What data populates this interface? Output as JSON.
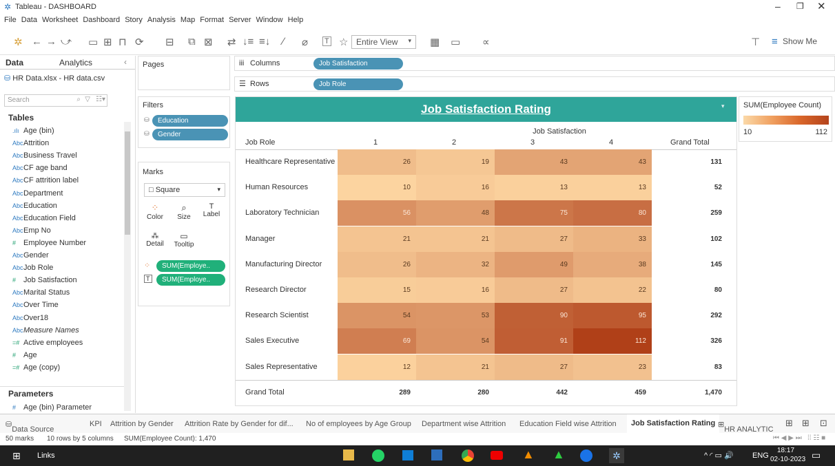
{
  "app_title": "Tableau - DASHBOARD",
  "menu": [
    "File",
    "Data",
    "Worksheet",
    "Dashboard",
    "Story",
    "Analysis",
    "Map",
    "Format",
    "Server",
    "Window",
    "Help"
  ],
  "toolbar": {
    "view_mode": "Entire View",
    "show_me": "Show Me"
  },
  "data_pane": {
    "tab_data": "Data",
    "tab_analytics": "Analytics",
    "datasource": "HR Data.xlsx - HR data.csv",
    "search_placeholder": "Search",
    "tables_header": "Tables",
    "fields": [
      {
        "type": ".ılı",
        "name": "Age (bin)"
      },
      {
        "type": "Abc",
        "name": "Attrition"
      },
      {
        "type": "Abc",
        "name": "Business Travel"
      },
      {
        "type": "Abc",
        "name": "CF age band"
      },
      {
        "type": "Abc",
        "name": "CF attrition label"
      },
      {
        "type": "Abc",
        "name": "Department"
      },
      {
        "type": "Abc",
        "name": "Education"
      },
      {
        "type": "Abc",
        "name": "Education Field"
      },
      {
        "type": "Abc",
        "name": "Emp No"
      },
      {
        "type": "#",
        "name": "Employee Number"
      },
      {
        "type": "Abc",
        "name": "Gender"
      },
      {
        "type": "Abc",
        "name": "Job Role"
      },
      {
        "type": "#",
        "name": "Job Satisfaction"
      },
      {
        "type": "Abc",
        "name": "Marital Status"
      },
      {
        "type": "Abc",
        "name": "Over Time"
      },
      {
        "type": "Abc",
        "name": "Over18"
      },
      {
        "type": "Abc",
        "name": "Measure Names"
      },
      {
        "type": "=#",
        "name": "Active employees"
      },
      {
        "type": "#",
        "name": "Age"
      },
      {
        "type": "=#",
        "name": "Age (copy)"
      }
    ],
    "parameters_header": "Parameters",
    "parameters": [
      {
        "type": "#",
        "name": "Age (bin) Parameter"
      }
    ]
  },
  "shelves": {
    "pages": "Pages",
    "filters": "Filters",
    "filter_pills": [
      "Education",
      "Gender"
    ],
    "marks": "Marks",
    "mark_type": "Square",
    "mark_buttons": [
      "Color",
      "Size",
      "Label",
      "Detail",
      "Tooltip"
    ],
    "mark_pills": [
      "SUM(Employe..",
      "SUM(Employe.."
    ],
    "columns_label": "Columns",
    "columns_pill": "Job Satisfaction",
    "rows_label": "Rows",
    "rows_pill": "Job Role"
  },
  "view": {
    "title": "Job Satisfaction Rating",
    "col_header": "Job Satisfaction",
    "row_header": "Job Role",
    "columns": [
      "1",
      "2",
      "3",
      "4"
    ],
    "grand_total_label": "Grand Total",
    "rows": [
      {
        "role": "Healthcare Representative",
        "values": [
          "26",
          "19",
          "43",
          "43"
        ],
        "total": "131"
      },
      {
        "role": "Human Resources",
        "values": [
          "10",
          "16",
          "13",
          "13"
        ],
        "total": "52"
      },
      {
        "role": "Laboratory Technician",
        "values": [
          "56",
          "48",
          "75",
          "80"
        ],
        "total": "259"
      },
      {
        "role": "Manager",
        "values": [
          "21",
          "21",
          "27",
          "33"
        ],
        "total": "102"
      },
      {
        "role": "Manufacturing Director",
        "values": [
          "26",
          "32",
          "49",
          "38"
        ],
        "total": "145"
      },
      {
        "role": "Research Director",
        "values": [
          "15",
          "16",
          "27",
          "22"
        ],
        "total": "80"
      },
      {
        "role": "Research Scientist",
        "values": [
          "54",
          "53",
          "90",
          "95"
        ],
        "total": "292"
      },
      {
        "role": "Sales Executive",
        "values": [
          "69",
          "54",
          "91",
          "112"
        ],
        "total": "326"
      },
      {
        "role": "Sales Representative",
        "values": [
          "12",
          "21",
          "27",
          "23"
        ],
        "total": "83"
      }
    ],
    "col_totals": [
      "289",
      "280",
      "442",
      "459"
    ],
    "grand_total": "1,470"
  },
  "legend": {
    "title": "SUM(Employee Count)",
    "min": "10",
    "max": "112",
    "color_low": "#f8c588",
    "color_high": "#b4441d"
  },
  "sheet_tabs": [
    "Data Source",
    "KPI",
    "Attrition by Gender",
    "Attrition Rate by Gender for dif...",
    "No of employees by Age Group",
    "Department wise Attrition",
    "Education Field wise Attrition",
    "Job Satisfaction Rating",
    "HR ANALYTIC"
  ],
  "status": {
    "marks": "50 marks",
    "rowscols": "10 rows by 5 columns",
    "sum": "SUM(Employee Count): 1,470"
  },
  "taskbar": {
    "links": "Links",
    "lang": "ENG",
    "time": "18:17",
    "date": "02-10-2023"
  }
}
